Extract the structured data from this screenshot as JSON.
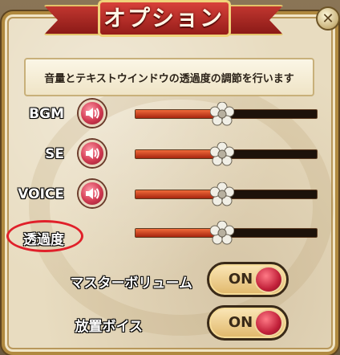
{
  "dialog": {
    "title": "オプション",
    "close_icon": "close-icon",
    "description": "音量とテキストウインドウの透過度の調節を行います"
  },
  "sliders": [
    {
      "label": "BGM",
      "has_speaker": true,
      "value": 0.48,
      "icon": "speaker-icon"
    },
    {
      "label": "SE",
      "has_speaker": true,
      "value": 0.48,
      "icon": "speaker-icon"
    },
    {
      "label": "VOICE",
      "has_speaker": true,
      "value": 0.48,
      "icon": "speaker-icon"
    },
    {
      "label": "透過度",
      "has_speaker": false,
      "value": 0.48,
      "icon": ""
    }
  ],
  "toggles": [
    {
      "label": "マスターボリューム",
      "state": "ON"
    },
    {
      "label": "放置ボイス",
      "state": "ON"
    }
  ],
  "colors": {
    "title_red": "#b32621",
    "slider_fill": "#d8451c",
    "highlight_ring": "#e0202a",
    "panel_bg": "#e8dcc0"
  }
}
